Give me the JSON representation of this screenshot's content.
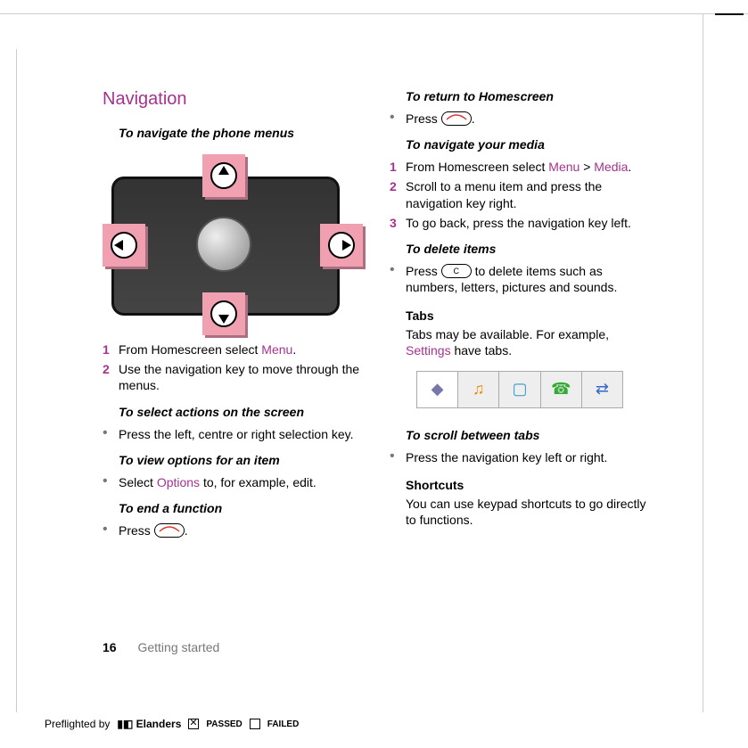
{
  "left": {
    "heading": "Navigation",
    "sub1": "To navigate the phone menus",
    "steps1": [
      {
        "n": "1",
        "pre": "From Homescreen select ",
        "link": "Menu",
        "post": "."
      },
      {
        "n": "2",
        "text": "Use the navigation key to move through the menus."
      }
    ],
    "sub2": "To select actions on the screen",
    "bullet2": "Press the left, centre or right selection key.",
    "sub3": "To view options for an item",
    "bullet3_pre": "Select ",
    "bullet3_link": "Options",
    "bullet3_post": " to, for example, edit.",
    "sub4": "To end a function",
    "bullet4_pre": "Press ",
    "bullet4_post": "."
  },
  "right": {
    "sub1": "To return to Homescreen",
    "bullet1_pre": "Press ",
    "bullet1_post": ".",
    "sub2": "To navigate your media",
    "steps2": [
      {
        "n": "1",
        "pre": "From Homescreen select ",
        "link1": "Menu",
        "mid": " > ",
        "link2": "Media",
        "post": "."
      },
      {
        "n": "2",
        "text": "Scroll to a menu item and press the navigation key right."
      },
      {
        "n": "3",
        "text": "To go back, press the navigation key left."
      }
    ],
    "sub3": "To delete items",
    "bullet3_pre": "Press ",
    "bullet3_post": " to delete items such as numbers, letters, pictures and sounds.",
    "c_label": "C",
    "tabs_head": "Tabs",
    "tabs_text_pre": "Tabs may be available. For example, ",
    "tabs_link": "Settings",
    "tabs_text_post": " have tabs.",
    "sub4": "To scroll between tabs",
    "bullet4": "Press the navigation key left or right.",
    "short_head": "Shortcuts",
    "short_text": "You can use keypad shortcuts to go directly to functions."
  },
  "footer": {
    "page": "16",
    "section": "Getting started"
  },
  "preflight": {
    "label": "Preflighted by",
    "brand": "Elanders",
    "passed": "PASSED",
    "failed": "FAILED"
  }
}
